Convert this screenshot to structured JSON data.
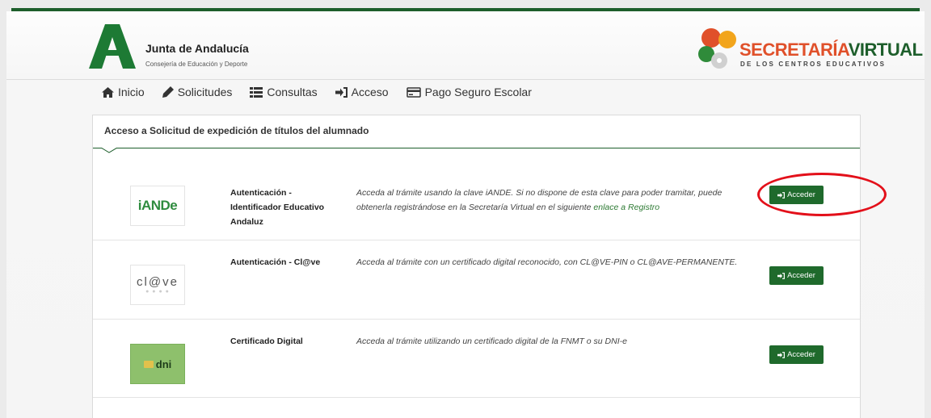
{
  "header": {
    "org_title": "Junta de Andalucía",
    "org_subtitle": "Consejería de Educación y Deporte",
    "brand_part1": "SECRETARÍA",
    "brand_part2": "VIRTUAL",
    "brand_subtitle": "DE LOS CENTROS EDUCATIVOS"
  },
  "nav": {
    "items": [
      {
        "label": "Inicio",
        "icon": "home-icon"
      },
      {
        "label": "Solicitudes",
        "icon": "pencil-icon"
      },
      {
        "label": "Consultas",
        "icon": "list-icon"
      },
      {
        "label": "Acceso",
        "icon": "sign-in-icon"
      },
      {
        "label": "Pago Seguro Escolar",
        "icon": "credit-card-icon"
      }
    ]
  },
  "panel": {
    "title": "Acceso a Solicitud de expedición de títulos del alumnado",
    "methods": [
      {
        "logo_text": "iANDe",
        "name": "Autenticación - Identificador Educativo Andaluz",
        "description": "Acceda al trámite usando la clave iANDE. Si no dispone de esta clave para poder tramitar, puede obtenerla registrándose en la Secretaría Virtual en el siguiente ",
        "link_text": "enlace a Registro",
        "button_label": "Acceder"
      },
      {
        "logo_text": "cl@ve",
        "name": "Autenticación - Cl@ve",
        "description": "Acceda al trámite con un certificado digital reconocido, con CL@VE-PIN o CL@AVE-PERMANENTE.",
        "button_label": "Acceder"
      },
      {
        "logo_text": "dni",
        "name": "Certificado Digital",
        "description": "Acceda al trámite utilizando un certificado digital de la FNMT o su DNI-e",
        "button_label": "Acceder"
      }
    ]
  },
  "colors": {
    "brand_green": "#1d5e2b",
    "button_green": "#1f6a2c",
    "brand_orange": "#e0502a",
    "highlight_red": "#e3101a"
  }
}
